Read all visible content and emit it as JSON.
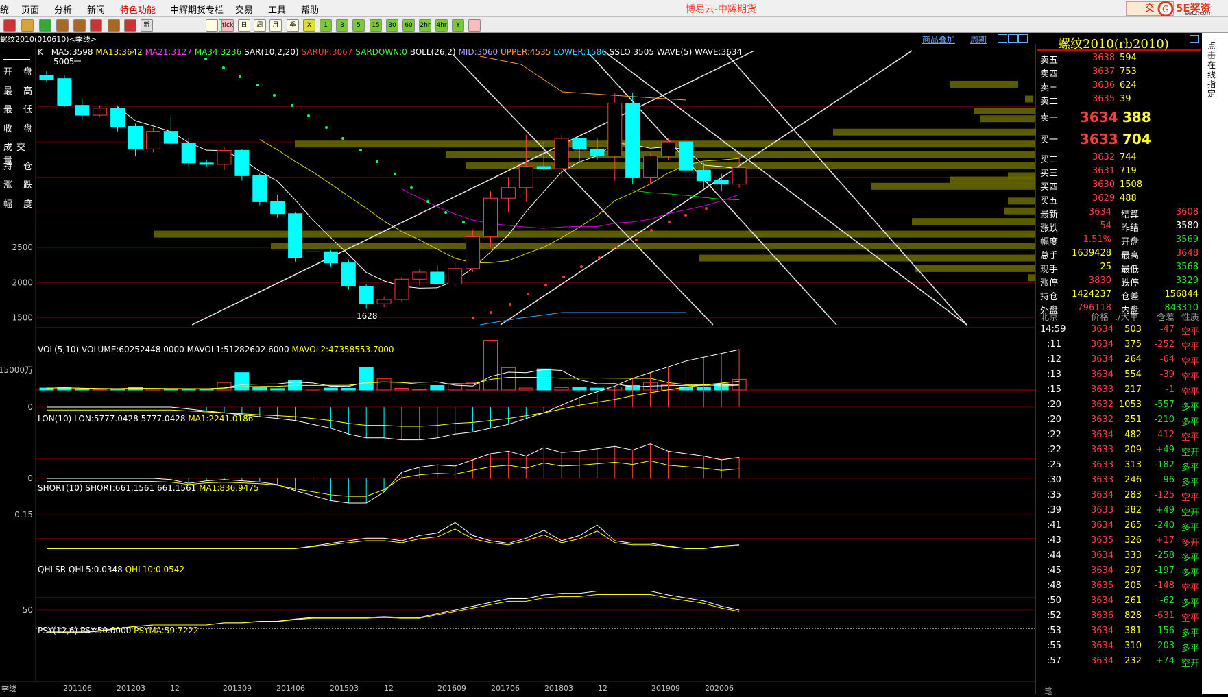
{
  "menu": [
    "统",
    "页面",
    "分析",
    "新闻",
    "特色功能",
    "中辉期货专栏",
    "交易",
    "工具",
    "帮助"
  ],
  "app_title": "博易云-中辉期货",
  "trade_button": "交",
  "logo_text": "5E奖资",
  "logo_sub": "setz.com",
  "toolbar_icons": [
    "home-icon",
    "notes-icon",
    "refresh-icon",
    "zoom-in-icon",
    "zoom-out-icon",
    "draw-icon",
    "erase-icon",
    "cup-icon",
    "news-icon",
    "table-icon",
    "calendar-icon",
    "tick-icon",
    "day-icon",
    "week-icon",
    "month-icon",
    "season-icon",
    "x-icon",
    "1-icon",
    "3-icon",
    "5-icon",
    "15-icon",
    "30-icon",
    "60-icon",
    "2h-icon",
    "4h-icon",
    "y-icon",
    "calc-icon"
  ],
  "toolbar_labels": [
    "",
    "",
    "",
    "",
    "",
    "",
    "",
    "",
    "新",
    "",
    "",
    "tick",
    "日",
    "周",
    "月",
    "季",
    "X",
    "1",
    "3",
    "5",
    "15",
    "30",
    "60",
    "2hr",
    "4hr",
    "Y",
    ""
  ],
  "contract_title": "螺纹2010(010610)<季线>",
  "chart_links": {
    "add_product": "商品叠加",
    "period": "周期"
  },
  "indicator_line": {
    "k": "K",
    "ma5": "MA5:3598",
    "ma13": "MA13:3642",
    "ma21": "MA21:3127",
    "ma34": "MA34:3236",
    "sar": "SAR(10,2,20)",
    "sarup": "SARUP:3067",
    "sardown": "SARDOWN:0",
    "boll": "BOLL(26,2)",
    "mid": "MID:3060",
    "upper": "UPPER:4535",
    "lower": "LOWER:1586",
    "sslo": "SSLO 3505",
    "wave": "WAVE(5) WAVE:3634"
  },
  "price_axis": [
    "2500",
    "2000",
    "1500"
  ],
  "price_annotations": {
    "high": "5005",
    "low": "1628"
  },
  "left_labels": [
    "开 盘",
    "最 高",
    "最 低",
    "收 盘",
    "成交量",
    "持 仓",
    "涨 跌",
    "幅 度"
  ],
  "vol_line": {
    "title": "VOL(5,10) VOLUME:60252448.0000",
    "mavol1": "MAVOL1:51282602.6000",
    "mavol2": "MAVOL2:47358553.7000"
  },
  "vol_axis": "15000万",
  "lon_line": {
    "title": "LON(10) LON:5777.0428",
    "val": "5777.0428",
    "ma": "MA1:2241.0186"
  },
  "lon_axis": "0",
  "short_line": {
    "title": "SHORT(10) SHORT:661.1561",
    "val": "661.1561",
    "ma": "MA1:836.9475"
  },
  "short_axis": "0",
  "qhlsr_line": {
    "title": "QHLSR",
    "q5": "QHL5:0.0348",
    "q10": "QHL10:0.0542"
  },
  "qhlsr_axis": "0.15",
  "psy_line": {
    "title": "PSY(12,6) PSY:50.0000",
    "psyma": "PSYMA:59.7222"
  },
  "psy_axis": "50",
  "date_axis": [
    "季线",
    "201106",
    "201203",
    "12",
    "201309",
    "201406",
    "201503",
    "12",
    "201609",
    "201706",
    "201803",
    "12",
    "201909",
    "202006"
  ],
  "quote": {
    "title": "螺纹2010(rb2010)",
    "side_text": "点击在线指定",
    "asks": [
      {
        "label": "卖五",
        "price": "3638",
        "vol": "594"
      },
      {
        "label": "卖四",
        "price": "3637",
        "vol": "753"
      },
      {
        "label": "卖三",
        "price": "3636",
        "vol": "624"
      },
      {
        "label": "卖二",
        "price": "3635",
        "vol": "39"
      },
      {
        "label": "卖一",
        "price": "3634",
        "vol": "388"
      }
    ],
    "bids": [
      {
        "label": "买一",
        "price": "3633",
        "vol": "704"
      },
      {
        "label": "买二",
        "price": "3632",
        "vol": "744"
      },
      {
        "label": "买三",
        "price": "3631",
        "vol": "719"
      },
      {
        "label": "买四",
        "price": "3630",
        "vol": "1508"
      },
      {
        "label": "买五",
        "price": "3629",
        "vol": "488"
      }
    ],
    "stats": [
      {
        "l1": "最新",
        "v1": "3634",
        "c1": "red",
        "l2": "结算",
        "v2": "3608",
        "c2": "red"
      },
      {
        "l1": "涨跌",
        "v1": "54",
        "c1": "red",
        "l2": "昨结",
        "v2": "3580",
        "c2": "wht"
      },
      {
        "l1": "幅度",
        "v1": "1.51%",
        "c1": "red",
        "l2": "开盘",
        "v2": "3569",
        "c2": "grn"
      },
      {
        "l1": "总手",
        "v1": "1639428",
        "c1": "yel",
        "l2": "最高",
        "v2": "3648",
        "c2": "red"
      },
      {
        "l1": "现手",
        "v1": "25",
        "c1": "yel",
        "l2": "最低",
        "v2": "3568",
        "c2": "grn"
      },
      {
        "l1": "涨停",
        "v1": "3830",
        "c1": "red",
        "l2": "跌停",
        "v2": "3329",
        "c2": "grn"
      },
      {
        "l1": "持仓",
        "v1": "1424237",
        "c1": "yel",
        "l2": "仓差",
        "v2": "156844",
        "c2": "yel"
      },
      {
        "l1": "外盘",
        "v1": "796118",
        "c1": "red",
        "l2": "内盘",
        "v2": "843310",
        "c2": "grn"
      }
    ],
    "tick_header": {
      "time": "北京",
      "price": "价格",
      "vol": "./大单",
      "oi": "仓差",
      "nature": "性质"
    },
    "ticks": [
      {
        "t": "14:59",
        "p": "3634",
        "v": "503",
        "d": "-47",
        "n": "空平",
        "pc": "red",
        "dc": "red",
        "nc": "red"
      },
      {
        "t": ":11",
        "p": "3634",
        "v": "375",
        "d": "-252",
        "n": "空平",
        "pc": "red",
        "dc": "red",
        "nc": "red"
      },
      {
        "t": ":12",
        "p": "3634",
        "v": "264",
        "d": "-64",
        "n": "空平",
        "pc": "red",
        "dc": "red",
        "nc": "red"
      },
      {
        "t": ":13",
        "p": "3634",
        "v": "554",
        "d": "-39",
        "n": "空平",
        "pc": "red",
        "dc": "red",
        "nc": "red"
      },
      {
        "t": ":15",
        "p": "3633",
        "v": "217",
        "d": "-1",
        "n": "空平",
        "pc": "red",
        "dc": "red",
        "nc": "red"
      },
      {
        "t": ":20",
        "p": "3632",
        "v": "1053",
        "d": "-557",
        "n": "多平",
        "pc": "red",
        "dc": "grn",
        "nc": "grn"
      },
      {
        "t": ":20",
        "p": "3632",
        "v": "251",
        "d": "-210",
        "n": "多平",
        "pc": "red",
        "dc": "grn",
        "nc": "grn"
      },
      {
        "t": ":22",
        "p": "3634",
        "v": "482",
        "d": "-412",
        "n": "空平",
        "pc": "red",
        "dc": "red",
        "nc": "red"
      },
      {
        "t": ":22",
        "p": "3633",
        "v": "209",
        "d": "+49",
        "n": "空开",
        "pc": "red",
        "dc": "grn",
        "nc": "grn"
      },
      {
        "t": ":25",
        "p": "3633",
        "v": "313",
        "d": "-182",
        "n": "多平",
        "pc": "red",
        "dc": "grn",
        "nc": "grn"
      },
      {
        "t": ":30",
        "p": "3633",
        "v": "246",
        "d": "-96",
        "n": "多平",
        "pc": "red",
        "dc": "grn",
        "nc": "grn"
      },
      {
        "t": ":35",
        "p": "3634",
        "v": "283",
        "d": "-125",
        "n": "空平",
        "pc": "red",
        "dc": "red",
        "nc": "red"
      },
      {
        "t": ":39",
        "p": "3633",
        "v": "382",
        "d": "+49",
        "n": "空开",
        "pc": "red",
        "dc": "grn",
        "nc": "grn"
      },
      {
        "t": ":41",
        "p": "3634",
        "v": "265",
        "d": "-240",
        "n": "多平",
        "pc": "red",
        "dc": "grn",
        "nc": "grn"
      },
      {
        "t": ":43",
        "p": "3635",
        "v": "326",
        "d": "+17",
        "n": "多开",
        "pc": "red",
        "dc": "red",
        "nc": "red"
      },
      {
        "t": ":44",
        "p": "3634",
        "v": "333",
        "d": "-258",
        "n": "多平",
        "pc": "red",
        "dc": "grn",
        "nc": "grn"
      },
      {
        "t": ":45",
        "p": "3634",
        "v": "297",
        "d": "-197",
        "n": "多平",
        "pc": "red",
        "dc": "grn",
        "nc": "grn"
      },
      {
        "t": ":48",
        "p": "3635",
        "v": "205",
        "d": "-148",
        "n": "空平",
        "pc": "red",
        "dc": "red",
        "nc": "red"
      },
      {
        "t": ":50",
        "p": "3634",
        "v": "261",
        "d": "-62",
        "n": "多平",
        "pc": "red",
        "dc": "grn",
        "nc": "grn"
      },
      {
        "t": ":52",
        "p": "3636",
        "v": "828",
        "d": "-631",
        "n": "空平",
        "pc": "red",
        "dc": "red",
        "nc": "red"
      },
      {
        "t": ":53",
        "p": "3634",
        "v": "381",
        "d": "-156",
        "n": "多平",
        "pc": "red",
        "dc": "grn",
        "nc": "grn"
      },
      {
        "t": ":55",
        "p": "3634",
        "v": "310",
        "d": "-203",
        "n": "多平",
        "pc": "red",
        "dc": "grn",
        "nc": "grn"
      },
      {
        "t": ":57",
        "p": "3634",
        "v": "232",
        "d": "+74",
        "n": "空开",
        "pc": "red",
        "dc": "grn",
        "nc": "grn"
      }
    ],
    "footer": "笔"
  },
  "colors": {
    "up": "#ff3b3b",
    "down": "#00ffff",
    "olive": "#6b6b00",
    "ma5": "#ffffff",
    "ma13": "#ffff00",
    "ma21": "#ff00ff",
    "ma34": "#00ff00"
  },
  "candles": [
    {
      "o": 4950,
      "h": 5005,
      "l": 4850,
      "c": 4890
    },
    {
      "o": 4900,
      "h": 4950,
      "l": 4500,
      "c": 4520
    },
    {
      "o": 4520,
      "h": 4620,
      "l": 4320,
      "c": 4380
    },
    {
      "o": 4380,
      "h": 4520,
      "l": 4350,
      "c": 4480
    },
    {
      "o": 4480,
      "h": 4520,
      "l": 4150,
      "c": 4220
    },
    {
      "o": 4220,
      "h": 4260,
      "l": 3800,
      "c": 3900
    },
    {
      "o": 3900,
      "h": 4200,
      "l": 3850,
      "c": 4150
    },
    {
      "o": 4150,
      "h": 4350,
      "l": 3950,
      "c": 3980
    },
    {
      "o": 3980,
      "h": 4050,
      "l": 3650,
      "c": 3700
    },
    {
      "o": 3700,
      "h": 3750,
      "l": 3650,
      "c": 3680
    },
    {
      "o": 3680,
      "h": 3920,
      "l": 3600,
      "c": 3880
    },
    {
      "o": 3880,
      "h": 3900,
      "l": 3450,
      "c": 3520
    },
    {
      "o": 3520,
      "h": 3550,
      "l": 3100,
      "c": 3150
    },
    {
      "o": 3150,
      "h": 3250,
      "l": 2920,
      "c": 2980
    },
    {
      "o": 2980,
      "h": 3000,
      "l": 2300,
      "c": 2350
    },
    {
      "o": 2350,
      "h": 2480,
      "l": 2330,
      "c": 2440
    },
    {
      "o": 2440,
      "h": 2460,
      "l": 2230,
      "c": 2280
    },
    {
      "o": 2280,
      "h": 2330,
      "l": 1900,
      "c": 1950
    },
    {
      "o": 1950,
      "h": 1980,
      "l": 1628,
      "c": 1700
    },
    {
      "o": 1700,
      "h": 1800,
      "l": 1650,
      "c": 1760
    },
    {
      "o": 1760,
      "h": 2080,
      "l": 1720,
      "c": 2050
    },
    {
      "o": 2050,
      "h": 2200,
      "l": 1960,
      "c": 2150
    },
    {
      "o": 2150,
      "h": 2250,
      "l": 2000,
      "c": 1980
    },
    {
      "o": 1980,
      "h": 2300,
      "l": 1950,
      "c": 2200
    },
    {
      "o": 2200,
      "h": 2750,
      "l": 2150,
      "c": 2650
    },
    {
      "o": 2650,
      "h": 3300,
      "l": 2500,
      "c": 3200
    },
    {
      "o": 3200,
      "h": 3500,
      "l": 3000,
      "c": 3350
    },
    {
      "o": 3350,
      "h": 4100,
      "l": 3150,
      "c": 3650
    },
    {
      "o": 3650,
      "h": 4000,
      "l": 3600,
      "c": 3620
    },
    {
      "o": 3620,
      "h": 4100,
      "l": 3500,
      "c": 4050
    },
    {
      "o": 4050,
      "h": 4050,
      "l": 3700,
      "c": 3900
    },
    {
      "o": 3900,
      "h": 4050,
      "l": 3750,
      "c": 3800
    },
    {
      "o": 3800,
      "h": 4700,
      "l": 3450,
      "c": 4550
    },
    {
      "o": 4550,
      "h": 4700,
      "l": 3400,
      "c": 3500
    },
    {
      "o": 3500,
      "h": 3850,
      "l": 3400,
      "c": 3800
    },
    {
      "o": 3800,
      "h": 4050,
      "l": 3750,
      "c": 4000
    },
    {
      "o": 4000,
      "h": 4050,
      "l": 3500,
      "c": 3600
    },
    {
      "o": 3600,
      "h": 3700,
      "l": 3350,
      "c": 3450
    },
    {
      "o": 3450,
      "h": 3550,
      "l": 3300,
      "c": 3400
    },
    {
      "o": 3400,
      "h": 3800,
      "l": 3350,
      "c": 3634
    }
  ],
  "volumes": [
    8,
    10,
    4,
    2,
    4,
    12,
    5,
    3,
    2,
    3,
    30,
    70,
    12,
    6,
    40,
    12,
    8,
    7,
    90,
    45,
    7,
    3,
    18,
    23,
    28,
    200,
    90,
    8,
    85,
    10,
    12,
    8,
    12,
    18,
    30,
    20,
    13,
    12,
    25,
    43
  ],
  "lon": [
    0,
    0,
    0,
    0,
    0,
    0,
    0,
    0,
    -2,
    -4,
    -6,
    -8,
    -10,
    -12,
    -14,
    -18,
    -22,
    -28,
    -32,
    -32,
    -34,
    -34,
    -32,
    -28,
    -26,
    -22,
    -18,
    -12,
    -6,
    2,
    10,
    16,
    22,
    30,
    36,
    42,
    48,
    52,
    56,
    60
  ],
  "short": [
    0,
    0,
    0,
    0,
    0,
    0,
    0,
    -2,
    -8,
    -4,
    -2,
    -4,
    -6,
    -10,
    -20,
    -28,
    -36,
    -40,
    -40,
    -22,
    10,
    18,
    22,
    20,
    30,
    40,
    44,
    36,
    50,
    42,
    44,
    48,
    52,
    46,
    56,
    44,
    40,
    36,
    30,
    34
  ],
  "qhl": [
    0.02,
    0.02,
    0.02,
    0.02,
    0.02,
    0.02,
    0.02,
    0.02,
    0.02,
    0.02,
    0.02,
    0.02,
    0.02,
    0.02,
    0.02,
    0.03,
    0.04,
    0.05,
    0.06,
    0.06,
    0.05,
    0.07,
    0.08,
    0.12,
    0.07,
    0.05,
    0.04,
    0.06,
    0.09,
    0.05,
    0.07,
    0.11,
    0.05,
    0.04,
    0.04,
    0.03,
    0.02,
    0.02,
    0.03,
    0.035
  ],
  "psy": [
    20,
    20,
    20,
    22,
    25,
    28,
    30,
    30,
    30,
    30,
    33,
    33,
    35,
    35,
    38,
    40,
    40,
    40,
    40,
    41,
    40,
    40,
    45,
    50,
    55,
    60,
    65,
    65,
    70,
    72,
    72,
    75,
    75,
    75,
    75,
    70,
    66,
    62,
    55,
    50
  ]
}
